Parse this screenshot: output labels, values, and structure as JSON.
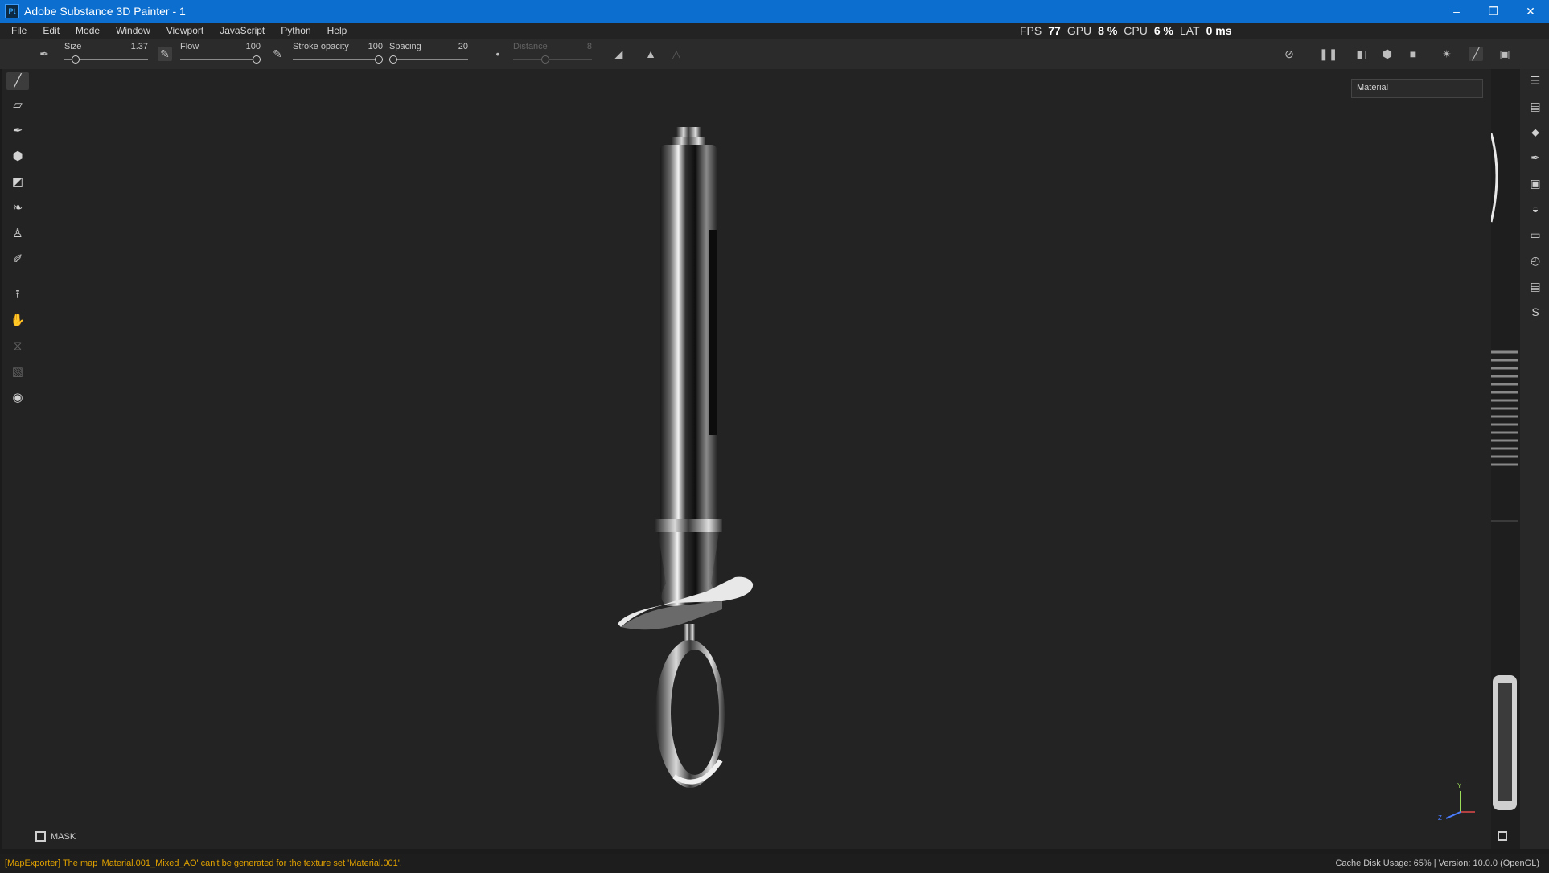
{
  "window": {
    "title": "Adobe Substance 3D Painter - 1",
    "app_icon_text": "Pt",
    "controls": [
      "minimize-icon",
      "restore-icon",
      "close-icon"
    ]
  },
  "menu": {
    "items": [
      "File",
      "Edit",
      "Mode",
      "Window",
      "Viewport",
      "JavaScript",
      "Python",
      "Help"
    ]
  },
  "performance": {
    "fps_label": "FPS",
    "fps_value": "77",
    "gpu_label": "GPU",
    "gpu_value": "8 %",
    "cpu_label": "CPU",
    "cpu_value": "6 %",
    "lat_label": "LAT",
    "lat_value": "0 ms"
  },
  "toolbar": {
    "size": {
      "label": "Size",
      "value": "1.37",
      "level": 0.1
    },
    "flow": {
      "label": "Flow",
      "value": "100",
      "level": 1.0
    },
    "stroke_opacity": {
      "label": "Stroke opacity",
      "value": "100",
      "level": 1.0
    },
    "spacing": {
      "label": "Spacing",
      "value": "20",
      "level": 0.0
    },
    "distance": {
      "label": "Distance",
      "value": "8",
      "level": 0.4,
      "disabled": true
    }
  },
  "viewport": {
    "channel_select": "Material",
    "mask_label": "MASK",
    "axis_labels": {
      "y": "Y",
      "z": "Z"
    }
  },
  "left_tools": [
    "paint-brush-icon",
    "eraser-icon",
    "projection-icon",
    "polygon-fill-icon",
    "geometry-mask-icon",
    "smudge-icon",
    "clone-stamp-icon",
    "color-picker-icon",
    "bake-export-icon",
    "material-picker-icon",
    "toggle-icon",
    "ruler-icon",
    "screenshot-icon"
  ],
  "right_tools": [
    "texture-set-list-icon",
    "texture-set-settings-icon",
    "layers-icon",
    "properties-icon",
    "display-settings-icon",
    "shader-settings-icon",
    "assets-icon",
    "history-icon",
    "log-icon",
    "substance-icon"
  ],
  "status": {
    "message": "[MapExporter] The map 'Material.001_Mixed_AO' can't be generated for the texture set 'Material.001'.",
    "right": "Cache Disk Usage:   65% | Version: 10.0.0 (OpenGL)"
  },
  "colors": {
    "titlebar": "#0c6fd0",
    "warning": "#e0a100",
    "background": "#232323"
  }
}
